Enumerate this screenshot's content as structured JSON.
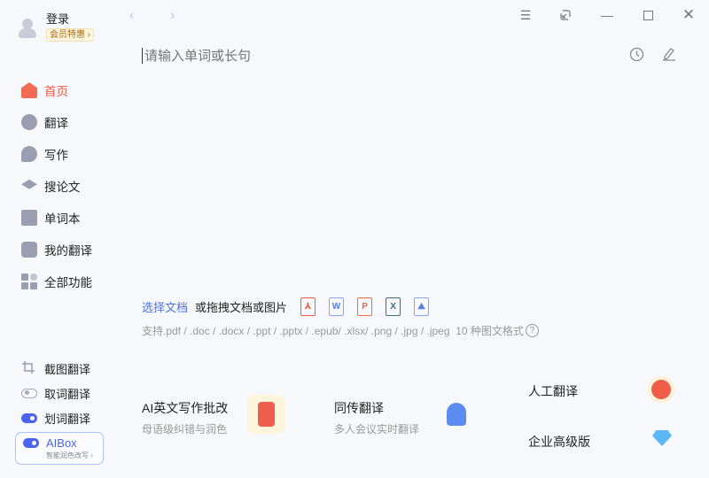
{
  "user": {
    "login": "登录",
    "vip": "会员特惠"
  },
  "nav": [
    {
      "label": "首页",
      "icon": "home-icon"
    },
    {
      "label": "翻译",
      "icon": "translate-icon"
    },
    {
      "label": "写作",
      "icon": "writing-icon"
    },
    {
      "label": "搜论文",
      "icon": "paper-icon"
    },
    {
      "label": "单词本",
      "icon": "wordbook-icon"
    },
    {
      "label": "我的翻译",
      "icon": "my-translation-icon"
    },
    {
      "label": "全部功能",
      "icon": "all-features-icon"
    }
  ],
  "tools": {
    "screenshot": "截图翻译",
    "pick": "取词翻译",
    "select": "划词翻译"
  },
  "aibox": {
    "title": "AIBox",
    "subtitle": "智能润色改写"
  },
  "search": {
    "placeholder": "请输入单词或长句"
  },
  "upload": {
    "choose": "选择文档",
    "drag": "或拖拽文档或图片",
    "formats": [
      "pdf",
      "W",
      "P",
      "X",
      "img"
    ],
    "support": "支持.pdf / .doc / .docx / .ppt / .pptx / .epub/ .xlsx/ .png / .jpg / .jpeg",
    "count": "10 种图文格式",
    "help": "?"
  },
  "cards": {
    "ai_title": "AI英文写作批改",
    "ai_sub": "母语级纠错与润色",
    "sim_title": "同传翻译",
    "sim_sub": "多人会议实时翻译",
    "human": "人工翻译",
    "enterprise": "企业高级版"
  },
  "colors": {
    "accent": "#4a63f0",
    "active": "#f05a45"
  }
}
